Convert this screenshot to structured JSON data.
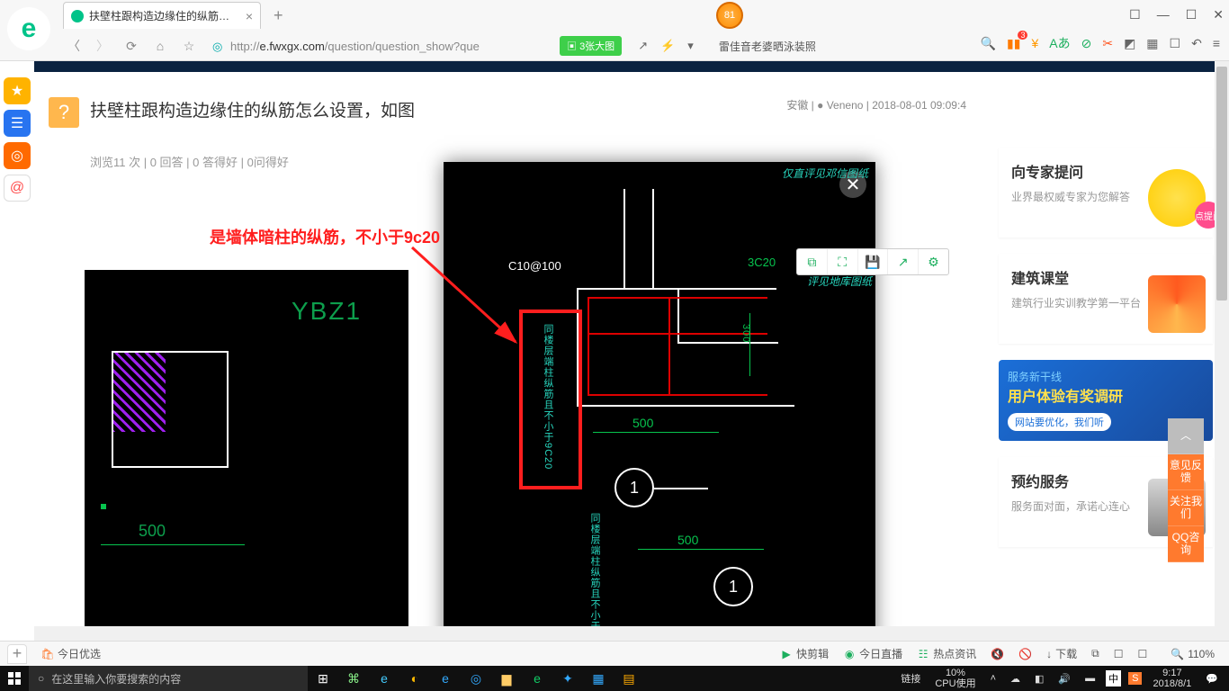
{
  "browser": {
    "tab_title": "扶壁柱跟构造边缘住的纵筋怎么设",
    "badge": "81",
    "url_prefix": "http://",
    "url_domain": "e.fwxgx.com",
    "url_path": "/question/question_show?que",
    "pill": "3张大图",
    "search_hint": "雷佳音老婆晒泳装照",
    "win": {
      "pin": "☐",
      "min": "—",
      "max": "☐",
      "close": "✕"
    }
  },
  "page": {
    "question_title": "扶壁柱跟构造边缘住的纵筋怎么设置，如图",
    "meta_region": "安徽",
    "meta_user": "Veneno",
    "meta_time": "2018-08-01 09:09:4",
    "stats": "浏览11 次 | 0 回答 | 0 答得好 | 0问得好",
    "cad_left": {
      "label": "YBZ1",
      "dim": "500"
    },
    "annotation": "是墙体暗柱的纵筋，不小于9c20",
    "lightbox": {
      "watermark1": "仅直评见邓信图纸",
      "watermark2": "评见地库图纸",
      "c_label": "C10@100",
      "rc_label": "3C20",
      "side_note": "同楼层端柱纵筋且不小于9C20",
      "dim500": "500",
      "dim300": "300",
      "circle": "1"
    },
    "lb_tools": {
      "copy": "⧉",
      "full": "⛶",
      "save": "💾",
      "share": "↗",
      "gear": "⚙"
    },
    "right": {
      "ask_title": "向专家提问",
      "ask_sub": "业界最权威专家为您解答",
      "class_title": "建筑课堂",
      "class_sub": "建筑行业实训教学第一平台",
      "banner_top": "服务新干线",
      "banner_big": "用户体验有奖调研",
      "banner_pill": "网站要优化，我们听",
      "book_title": "预约服务",
      "book_sub": "服务面对面，承诺心连心",
      "pink": "点提问"
    },
    "float": {
      "top": "︿",
      "fb": "意见反馈",
      "follow": "关注我们",
      "qq": "QQ咨询"
    }
  },
  "bottombar": {
    "today": "今日优选",
    "clip": "快剪辑",
    "live": "今日直播",
    "hot": "热点资讯",
    "down": "下载",
    "zoom": "110%"
  },
  "taskbar": {
    "search_placeholder": "在这里输入你要搜索的内容",
    "link": "链接",
    "cpu_pct": "10%",
    "cpu_lbl": "CPU使用",
    "ime": "中",
    "sogou": "S",
    "time": "9:17",
    "date": "2018/8/1"
  }
}
